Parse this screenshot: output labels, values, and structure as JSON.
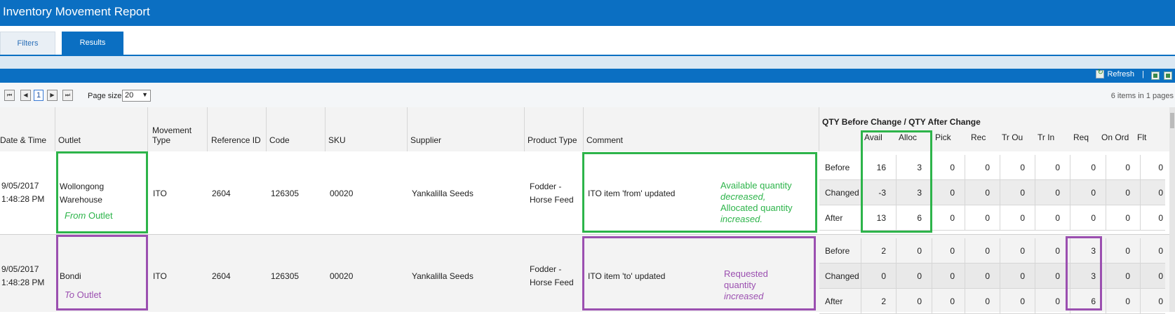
{
  "title": "Inventory Movement Report",
  "tabs": {
    "filters": "Filters",
    "results": "Results"
  },
  "toolbar": {
    "refresh": "Refresh",
    "separator": "|"
  },
  "pager": {
    "current_page": "1",
    "page_size_label": "Page size:",
    "page_size": "20",
    "items_text": "6 items in 1 pages"
  },
  "columns": {
    "datetime": "Date & Time",
    "outlet": "Outlet",
    "movement_type_1": "Movement",
    "movement_type_2": "Type",
    "reference_id": "Reference ID",
    "code": "Code",
    "sku": "SKU",
    "supplier": "Supplier",
    "product_type": "Product Type",
    "comment": "Comment",
    "qty_group": "QTY Before Change / QTY After Change",
    "qty": [
      "Avail",
      "Alloc",
      "Pick",
      "Rec",
      "Tr Ou",
      "Tr In",
      "Req",
      "On Ord",
      "Flt"
    ]
  },
  "rows": [
    {
      "date": "9/05/2017",
      "time": "1:48:28 PM",
      "outlet_1": "Wollongong",
      "outlet_2": "Warehouse",
      "movement_type": "ITO",
      "reference_id": "2604",
      "code": "126305",
      "sku": "00020",
      "supplier": "Yankalilla Seeds",
      "product_type_1": "Fodder -",
      "product_type_2": "Horse Feed",
      "comment": "ITO item 'from' updated",
      "sub": [
        {
          "label": "Before",
          "values": [
            "16",
            "3",
            "0",
            "0",
            "0",
            "0",
            "0",
            "0",
            "0"
          ]
        },
        {
          "label": "Changed",
          "values": [
            "-3",
            "3",
            "0",
            "0",
            "0",
            "0",
            "0",
            "0",
            "0"
          ]
        },
        {
          "label": "After",
          "values": [
            "13",
            "6",
            "0",
            "0",
            "0",
            "0",
            "0",
            "0",
            "0"
          ]
        }
      ]
    },
    {
      "date": "9/05/2017",
      "time": "1:48:28 PM",
      "outlet_1": "Bondi",
      "outlet_2": "",
      "movement_type": "ITO",
      "reference_id": "2604",
      "code": "126305",
      "sku": "00020",
      "supplier": "Yankalilla Seeds",
      "product_type_1": "Fodder -",
      "product_type_2": "Horse Feed",
      "comment": "ITO item 'to' updated",
      "sub": [
        {
          "label": "Before",
          "values": [
            "2",
            "0",
            "0",
            "0",
            "0",
            "0",
            "3",
            "0",
            "0"
          ]
        },
        {
          "label": "Changed",
          "values": [
            "0",
            "0",
            "0",
            "0",
            "0",
            "0",
            "3",
            "0",
            "0"
          ]
        },
        {
          "label": "After",
          "values": [
            "2",
            "0",
            "0",
            "0",
            "0",
            "0",
            "6",
            "0",
            "0"
          ]
        }
      ]
    }
  ],
  "annotations": {
    "from_outlet_italic": "From",
    "from_outlet_rest": " Outlet",
    "to_outlet_italic": "To",
    "to_outlet_rest": " Outlet",
    "green_note_1": "Available quantity",
    "green_note_2": "decreased,",
    "green_note_3": "Allocated quantity",
    "green_note_4": "increased.",
    "purple_note_1": "Requested",
    "purple_note_2": "quantity",
    "purple_note_3": "increased",
    "green_color": "#2db44a",
    "purple_color": "#9b4fb0"
  }
}
